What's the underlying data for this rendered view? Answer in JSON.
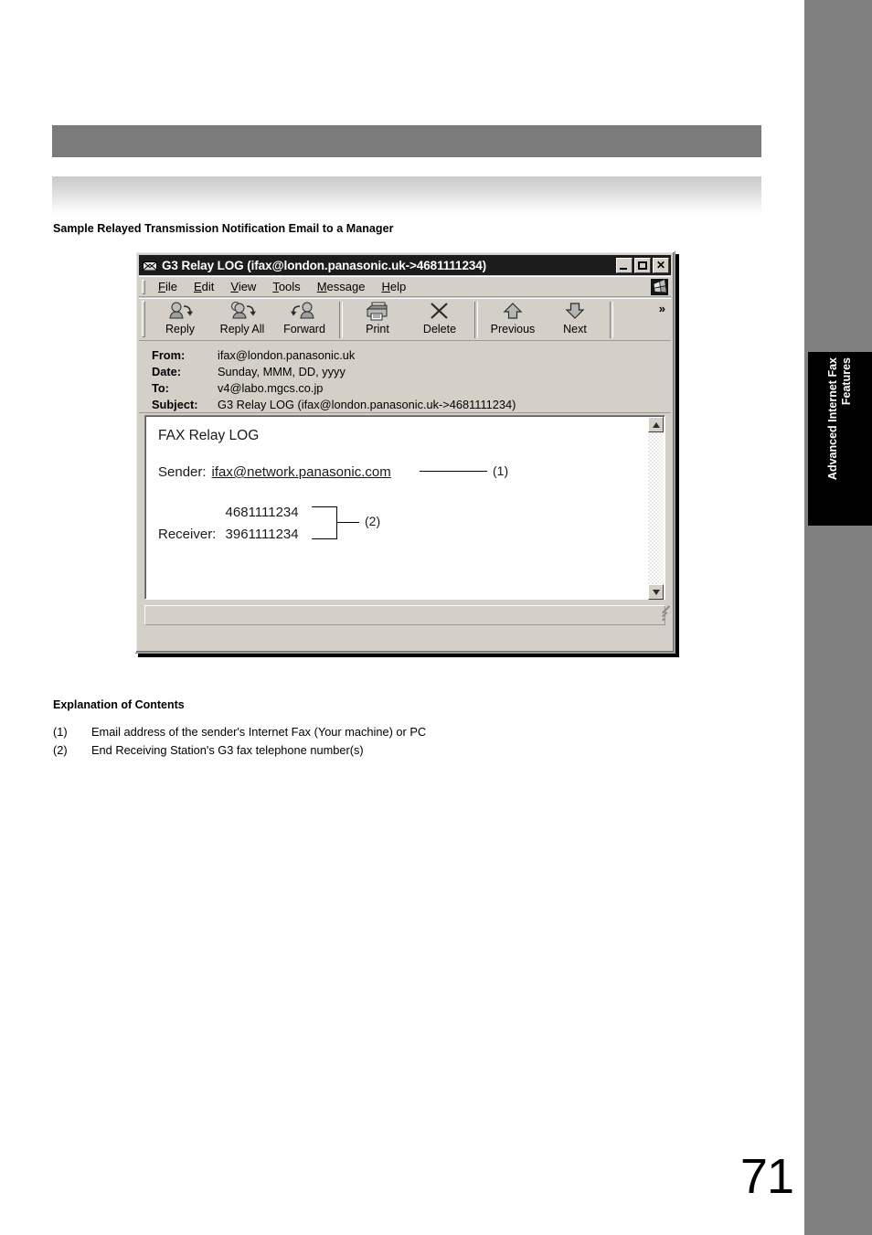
{
  "page": {
    "number": "71",
    "side_tab_line1": "Advanced Internet Fax",
    "side_tab_line2": "Features",
    "caption": "Sample Relayed Transmission Notification Email to a Manager"
  },
  "email_window": {
    "app_icon": "envelope-icon",
    "title": "G3 Relay LOG (ifax@london.panasonic.uk->4681111234)",
    "title_buttons": {
      "minimize": "minimize-icon",
      "maximize": "maximize-icon",
      "close": "✕"
    },
    "menus": [
      {
        "prefix": "",
        "accel": "F",
        "suffix": "ile"
      },
      {
        "prefix": "",
        "accel": "E",
        "suffix": "dit"
      },
      {
        "prefix": "",
        "accel": "V",
        "suffix": "iew"
      },
      {
        "prefix": "",
        "accel": "T",
        "suffix": "ools"
      },
      {
        "prefix": "",
        "accel": "M",
        "suffix": "essage"
      },
      {
        "prefix": "",
        "accel": "H",
        "suffix": "elp"
      }
    ],
    "toolbar": {
      "overflow_label": "»",
      "buttons": [
        {
          "label": "Reply",
          "icon": "reply-icon"
        },
        {
          "label": "Reply All",
          "icon": "reply-all-icon"
        },
        {
          "label": "Forward",
          "icon": "forward-icon"
        },
        {
          "label": "Print",
          "icon": "printer-icon"
        },
        {
          "label": "Delete",
          "icon": "delete-x-icon"
        },
        {
          "label": "Previous",
          "icon": "arrow-up-icon"
        },
        {
          "label": "Next",
          "icon": "arrow-down-icon"
        }
      ]
    },
    "headers": [
      {
        "label": "From:",
        "value": "ifax@london.panasonic.uk"
      },
      {
        "label": "Date:",
        "value": "Sunday,  MMM, DD, yyyy"
      },
      {
        "label": "To:",
        "value": "v4@labo.mgcs.co.jp"
      },
      {
        "label": "Subject:",
        "value": "G3 Relay LOG (ifax@london.panasonic.uk->4681111234)"
      }
    ],
    "body": {
      "title": "FAX Relay LOG",
      "sender_label": "Sender:",
      "sender_value": "ifax@network.panasonic.com",
      "receiver_label": "Receiver:",
      "receiver_values": [
        "4681111234",
        "3961111234"
      ],
      "callout_1": "(1)",
      "callout_2": "(2)"
    }
  },
  "explanation": {
    "title": "Explanation of Contents",
    "items": [
      {
        "num": "(1)",
        "text": "Email address of the sender's Internet Fax (Your machine) or PC"
      },
      {
        "num": "(2)",
        "text": "End Receiving Station's G3 fax telephone number(s)"
      }
    ]
  },
  "colors": {
    "header_bar": "#7b7b7b",
    "side_strip": "#808080",
    "side_tab_bg": "#000000",
    "window_face": "#d4d0c8",
    "titlebar": "#1c1c1c"
  }
}
